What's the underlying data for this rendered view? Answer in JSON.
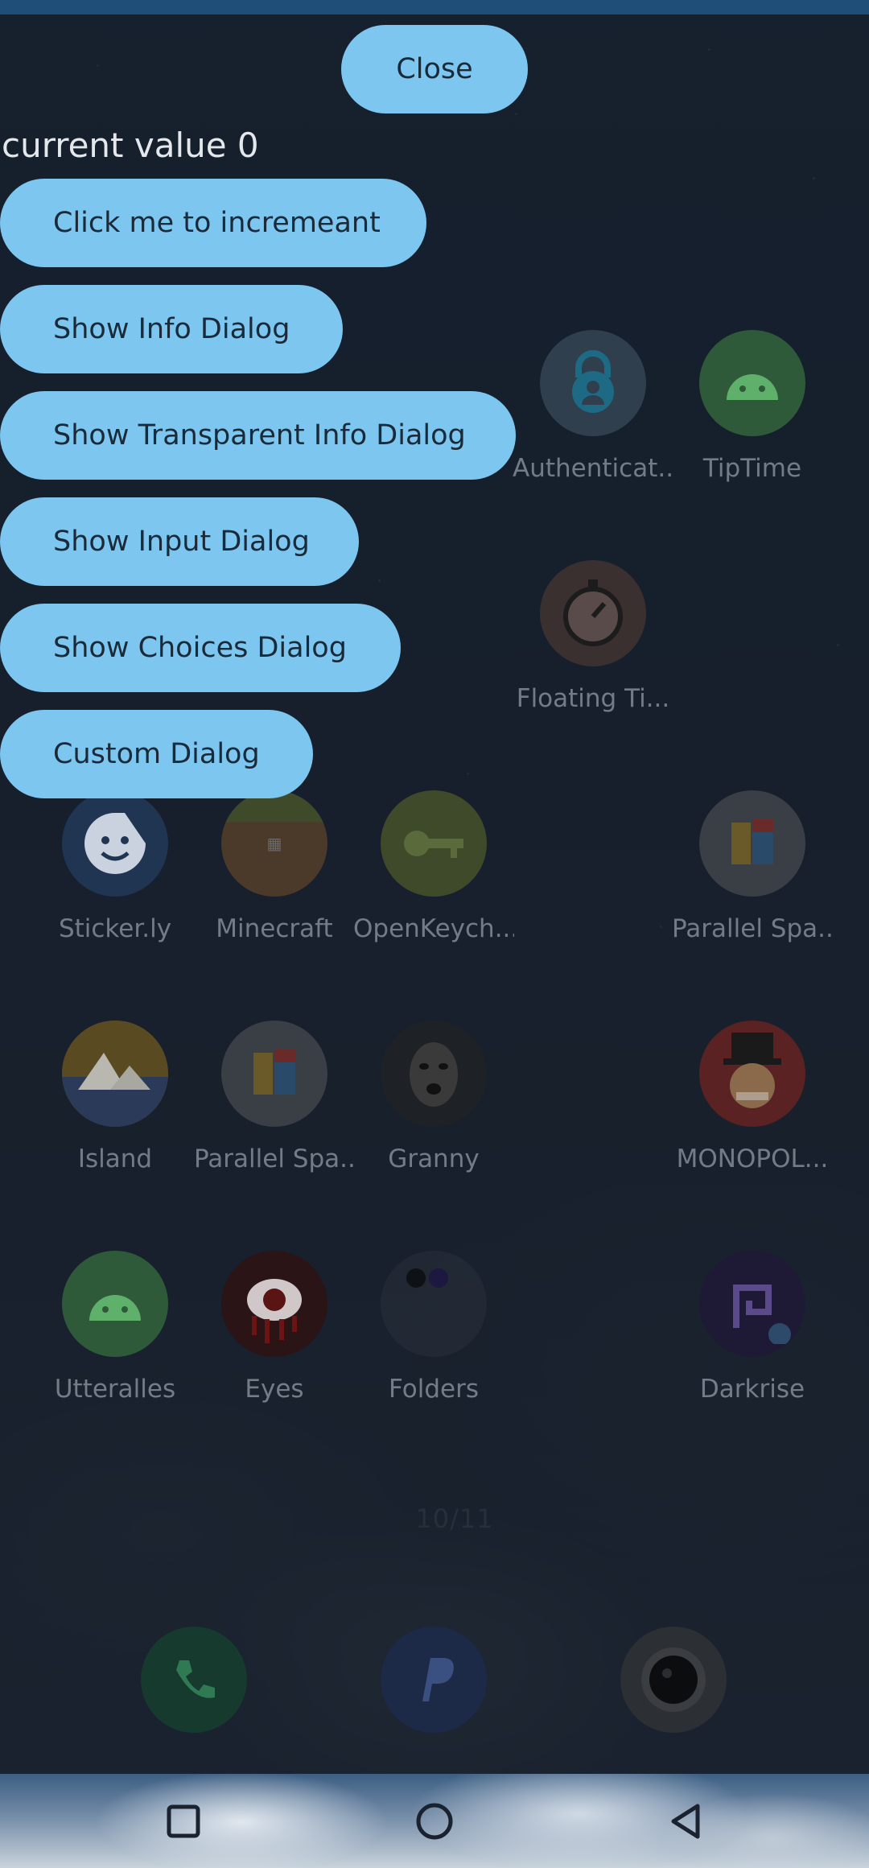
{
  "dialog": {
    "close_label": "Close",
    "value_text": "current value 0",
    "buttons": [
      "Click me to incremeant",
      "Show Info Dialog",
      "Show Transparent Info Dialog",
      "Show Input Dialog",
      "Show Choices Dialog",
      "Custom Dialog"
    ]
  },
  "home": {
    "apps": [
      {
        "label": "Authenticat...",
        "icon": "authenticator-icon"
      },
      {
        "label": "TipTime",
        "icon": "android-icon"
      },
      {
        "label": "Floating Ti...",
        "icon": "stopwatch-icon"
      },
      {
        "label": "Sticker.ly",
        "icon": "sticker-icon"
      },
      {
        "label": "Minecraft",
        "icon": "minecraft-icon"
      },
      {
        "label": "OpenKeych...",
        "icon": "key-icon"
      },
      {
        "label": "Parallel Spa...",
        "icon": "parallel-space-icon"
      },
      {
        "label": "Island",
        "icon": "island-icon"
      },
      {
        "label": "Parallel Spa...",
        "icon": "parallel-space-icon"
      },
      {
        "label": "Granny",
        "icon": "granny-icon"
      },
      {
        "label": "MONOPOL...",
        "icon": "monopoly-icon"
      },
      {
        "label": "Utteralles",
        "icon": "android-icon"
      },
      {
        "label": "Eyes",
        "icon": "eye-icon"
      },
      {
        "label": "Folders",
        "icon": "folder-icon"
      },
      {
        "label": "Darkrise",
        "icon": "darkrise-icon"
      }
    ],
    "page_indicator": "10/11",
    "dock": [
      "phone-icon",
      "paypal-icon",
      "camera-icon"
    ]
  },
  "navbar": {
    "recents": "recents-icon",
    "home": "home-icon",
    "back": "back-icon"
  },
  "colors": {
    "button_bg": "#7cc6f0",
    "button_text": "#1a2a38",
    "value_text": "#e4e8ec"
  }
}
